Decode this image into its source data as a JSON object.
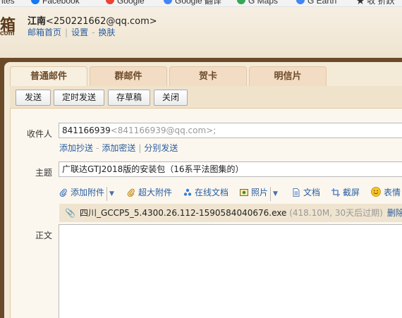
{
  "bookmarks": [
    {
      "label": "…ntes",
      "color": ""
    },
    {
      "label": "Facebook",
      "color": "#1877f2"
    },
    {
      "label": "Google",
      "color": "#ea4335"
    },
    {
      "label": "Google 翻译",
      "color": "#4285f4"
    },
    {
      "label": "G Maps",
      "color": "#34a853"
    },
    {
      "label": "G Earth",
      "color": "#4285f4"
    },
    {
      "label": "★ 收 折跃",
      "color": "#f4b400"
    }
  ],
  "header": {
    "logo_char": "箱",
    "logo_sub": "com",
    "user_name": "江南",
    "user_email": "<250221662@qq.com>",
    "links": [
      "邮箱首页",
      "设置",
      "换肤"
    ]
  },
  "tabs": [
    {
      "label": "普通邮件",
      "active": true
    },
    {
      "label": "群邮件",
      "active": false
    },
    {
      "label": "贺卡",
      "active": false
    },
    {
      "label": "明信片",
      "active": false
    }
  ],
  "toolbar": {
    "send": "发送",
    "schedule": "定时发送",
    "draft": "存草稿",
    "close": "关闭"
  },
  "compose": {
    "to_label": "收件人",
    "to_value": "841166939",
    "to_email": "<841166939@qq.com>;",
    "to_links": [
      "添加抄送",
      "添加密送",
      "分别发送"
    ],
    "subject_label": "主题",
    "subject_value": "广联达GTJ2018版的安装包（16系平法图集的）",
    "body_label": "正文"
  },
  "attach_tools": [
    {
      "label": "添加附件",
      "icon": "paperclip-icon",
      "caret": true
    },
    {
      "label": "超大附件",
      "icon": "paperclip-large-icon",
      "caret": false
    },
    {
      "label": "在线文档",
      "icon": "online-doc-icon",
      "caret": false
    },
    {
      "label": "照片",
      "icon": "photo-icon",
      "caret": true
    },
    {
      "label": "文档",
      "icon": "document-icon",
      "caret": false
    },
    {
      "label": "截屏",
      "icon": "screenshot-icon",
      "caret": false
    },
    {
      "label": "表情",
      "icon": "emoji-icon",
      "caret": false
    }
  ],
  "attachment": {
    "filename": "四川_GCCP5_5.4300.26.112-1590584040676.exe",
    "info": "(418.10M, 30天后过期)",
    "delete": "删除"
  },
  "colors": {
    "frame_brown": "#6b4a2a",
    "link_blue": "#2a5d9f"
  }
}
